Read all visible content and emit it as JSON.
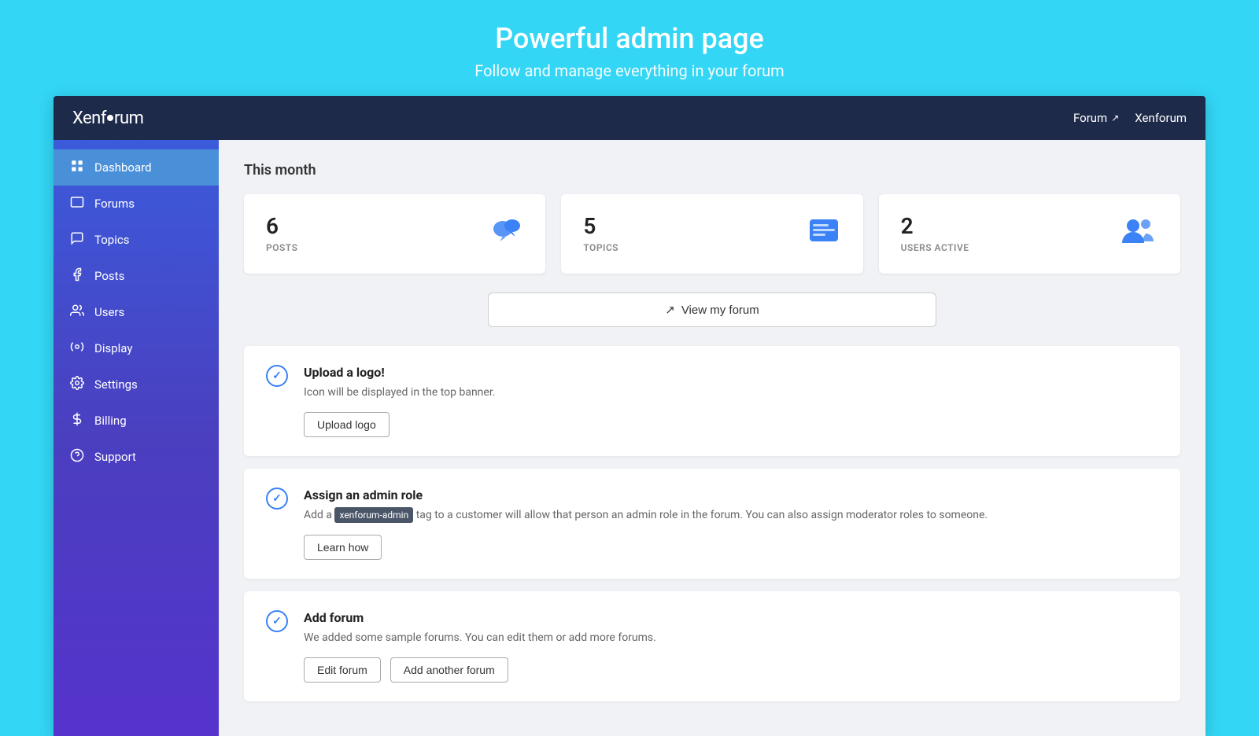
{
  "hero": {
    "title": "Powerful admin page",
    "subtitle": "Follow and manage everything in your forum"
  },
  "topbar": {
    "logo": "Xenforum",
    "forum_link": "Forum",
    "user": "Xenforum"
  },
  "sidebar": {
    "items": [
      {
        "id": "dashboard",
        "label": "Dashboard",
        "icon": "dashboard",
        "active": true
      },
      {
        "id": "forums",
        "label": "Forums",
        "icon": "forums"
      },
      {
        "id": "topics",
        "label": "Topics",
        "icon": "topics"
      },
      {
        "id": "posts",
        "label": "Posts",
        "icon": "posts"
      },
      {
        "id": "users",
        "label": "Users",
        "icon": "users"
      },
      {
        "id": "display",
        "label": "Display",
        "icon": "display"
      },
      {
        "id": "settings",
        "label": "Settings",
        "icon": "settings"
      },
      {
        "id": "billing",
        "label": "Billing",
        "icon": "billing"
      },
      {
        "id": "support",
        "label": "Support",
        "icon": "support"
      }
    ]
  },
  "content": {
    "section_title": "This month",
    "stats": [
      {
        "number": "6",
        "label": "POSTS",
        "icon": "posts"
      },
      {
        "number": "5",
        "label": "TOPICS",
        "icon": "topics"
      },
      {
        "number": "2",
        "label": "USERS ACTIVE",
        "icon": "users"
      }
    ],
    "view_forum_btn": "View my forum",
    "info_cards": [
      {
        "id": "upload-logo",
        "title": "Upload a logo!",
        "desc": "Icon will be displayed in the top banner.",
        "buttons": [
          "Upload logo"
        ]
      },
      {
        "id": "assign-admin",
        "title": "Assign an admin role",
        "desc_prefix": "Add a ",
        "desc_tag": "xenforum-admin",
        "desc_suffix": " tag to a customer will allow that person an admin role in the forum. You can also assign moderator roles to someone.",
        "buttons": [
          "Learn how"
        ]
      },
      {
        "id": "add-forum",
        "title": "Add forum",
        "desc": "We added some sample forums. You can edit them or add more forums.",
        "buttons": [
          "Edit forum",
          "Add another forum"
        ]
      }
    ]
  }
}
